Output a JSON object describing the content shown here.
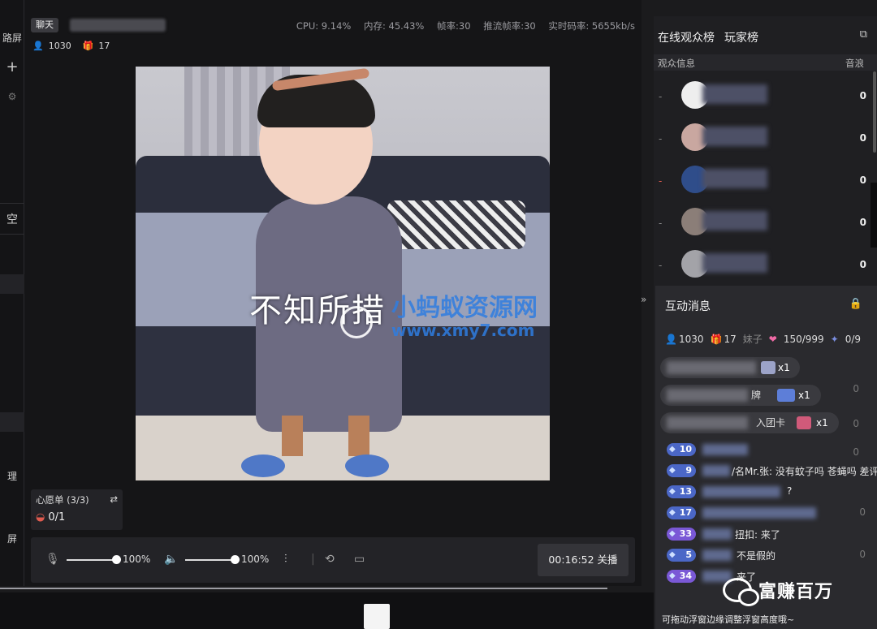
{
  "left_rail": {
    "top_label": "路屏",
    "plus": "+",
    "mid_label": "空",
    "manage_label": "理",
    "bottom_label": "屏"
  },
  "topbar": {
    "chat_tag": "聊天",
    "cpu": "CPU: 9.14%",
    "memory": "内存: 45.43%",
    "fps": "帧率:30",
    "push_fps": "推流帧率:30",
    "bitrate": "实时码率: 5655kb/s"
  },
  "counts": {
    "viewers": "1030",
    "gifts": "17"
  },
  "video": {
    "caption": "不知所措",
    "watermark_title": "小蚂蚁资源网",
    "watermark_url": "www.xmy7.com"
  },
  "wishlist": {
    "title": "心愿单 (3/3)",
    "value": "0/1"
  },
  "controls": {
    "mic_volume": "100%",
    "speaker_volume": "100%",
    "mic_level": 1.0,
    "speaker_level": 1.0,
    "timer": "00:16:52",
    "end_label": "关播"
  },
  "right_panel": {
    "tab_online": "在线观众榜",
    "tab_players": "玩家榜",
    "col_info": "观众信息",
    "col_score": "音浪",
    "viewers": [
      {
        "dash": "-",
        "score": "0"
      },
      {
        "dash": "-",
        "score": "0"
      },
      {
        "dash": "-",
        "score": "0"
      },
      {
        "dash": "-",
        "score": "0"
      },
      {
        "dash": "-",
        "score": "0"
      }
    ]
  },
  "messages": {
    "title": "互动消息",
    "viewers": "1030",
    "gifts": "17",
    "fragment": "妹子",
    "likes": "150/999",
    "tasks": "0/9",
    "bubbles": [
      {
        "label": "",
        "count": "x1"
      },
      {
        "label": "牌",
        "count": "x1"
      },
      {
        "label": "入团卡",
        "count": "x1"
      }
    ],
    "chat": [
      {
        "level": "10",
        "text": "",
        "zero": ""
      },
      {
        "level": "9",
        "text": "/名Mr.张: 没有蚊子吗 苍蝇吗 差评",
        "zero": ""
      },
      {
        "level": "13",
        "text": "?",
        "zero": ""
      },
      {
        "level": "17",
        "text": "",
        "zero": "0"
      },
      {
        "level": "33",
        "text": "扭扣: 来了",
        "zero": ""
      },
      {
        "level": "5",
        "text": "不是假的",
        "zero": "0"
      },
      {
        "level": "34",
        "text": "来了",
        "zero": ""
      }
    ],
    "hint": "可拖动浮窗边缘调整浮窗高度哦~",
    "zero_marks": [
      "0",
      "0",
      "0"
    ]
  },
  "wechat_badge": {
    "text": "富赚百万"
  },
  "colors": {
    "accent_blue": "#4b67c7",
    "accent_purple": "#7a58d6",
    "panel_bg": "#1f1f22",
    "watermark": "#2f7de0"
  }
}
